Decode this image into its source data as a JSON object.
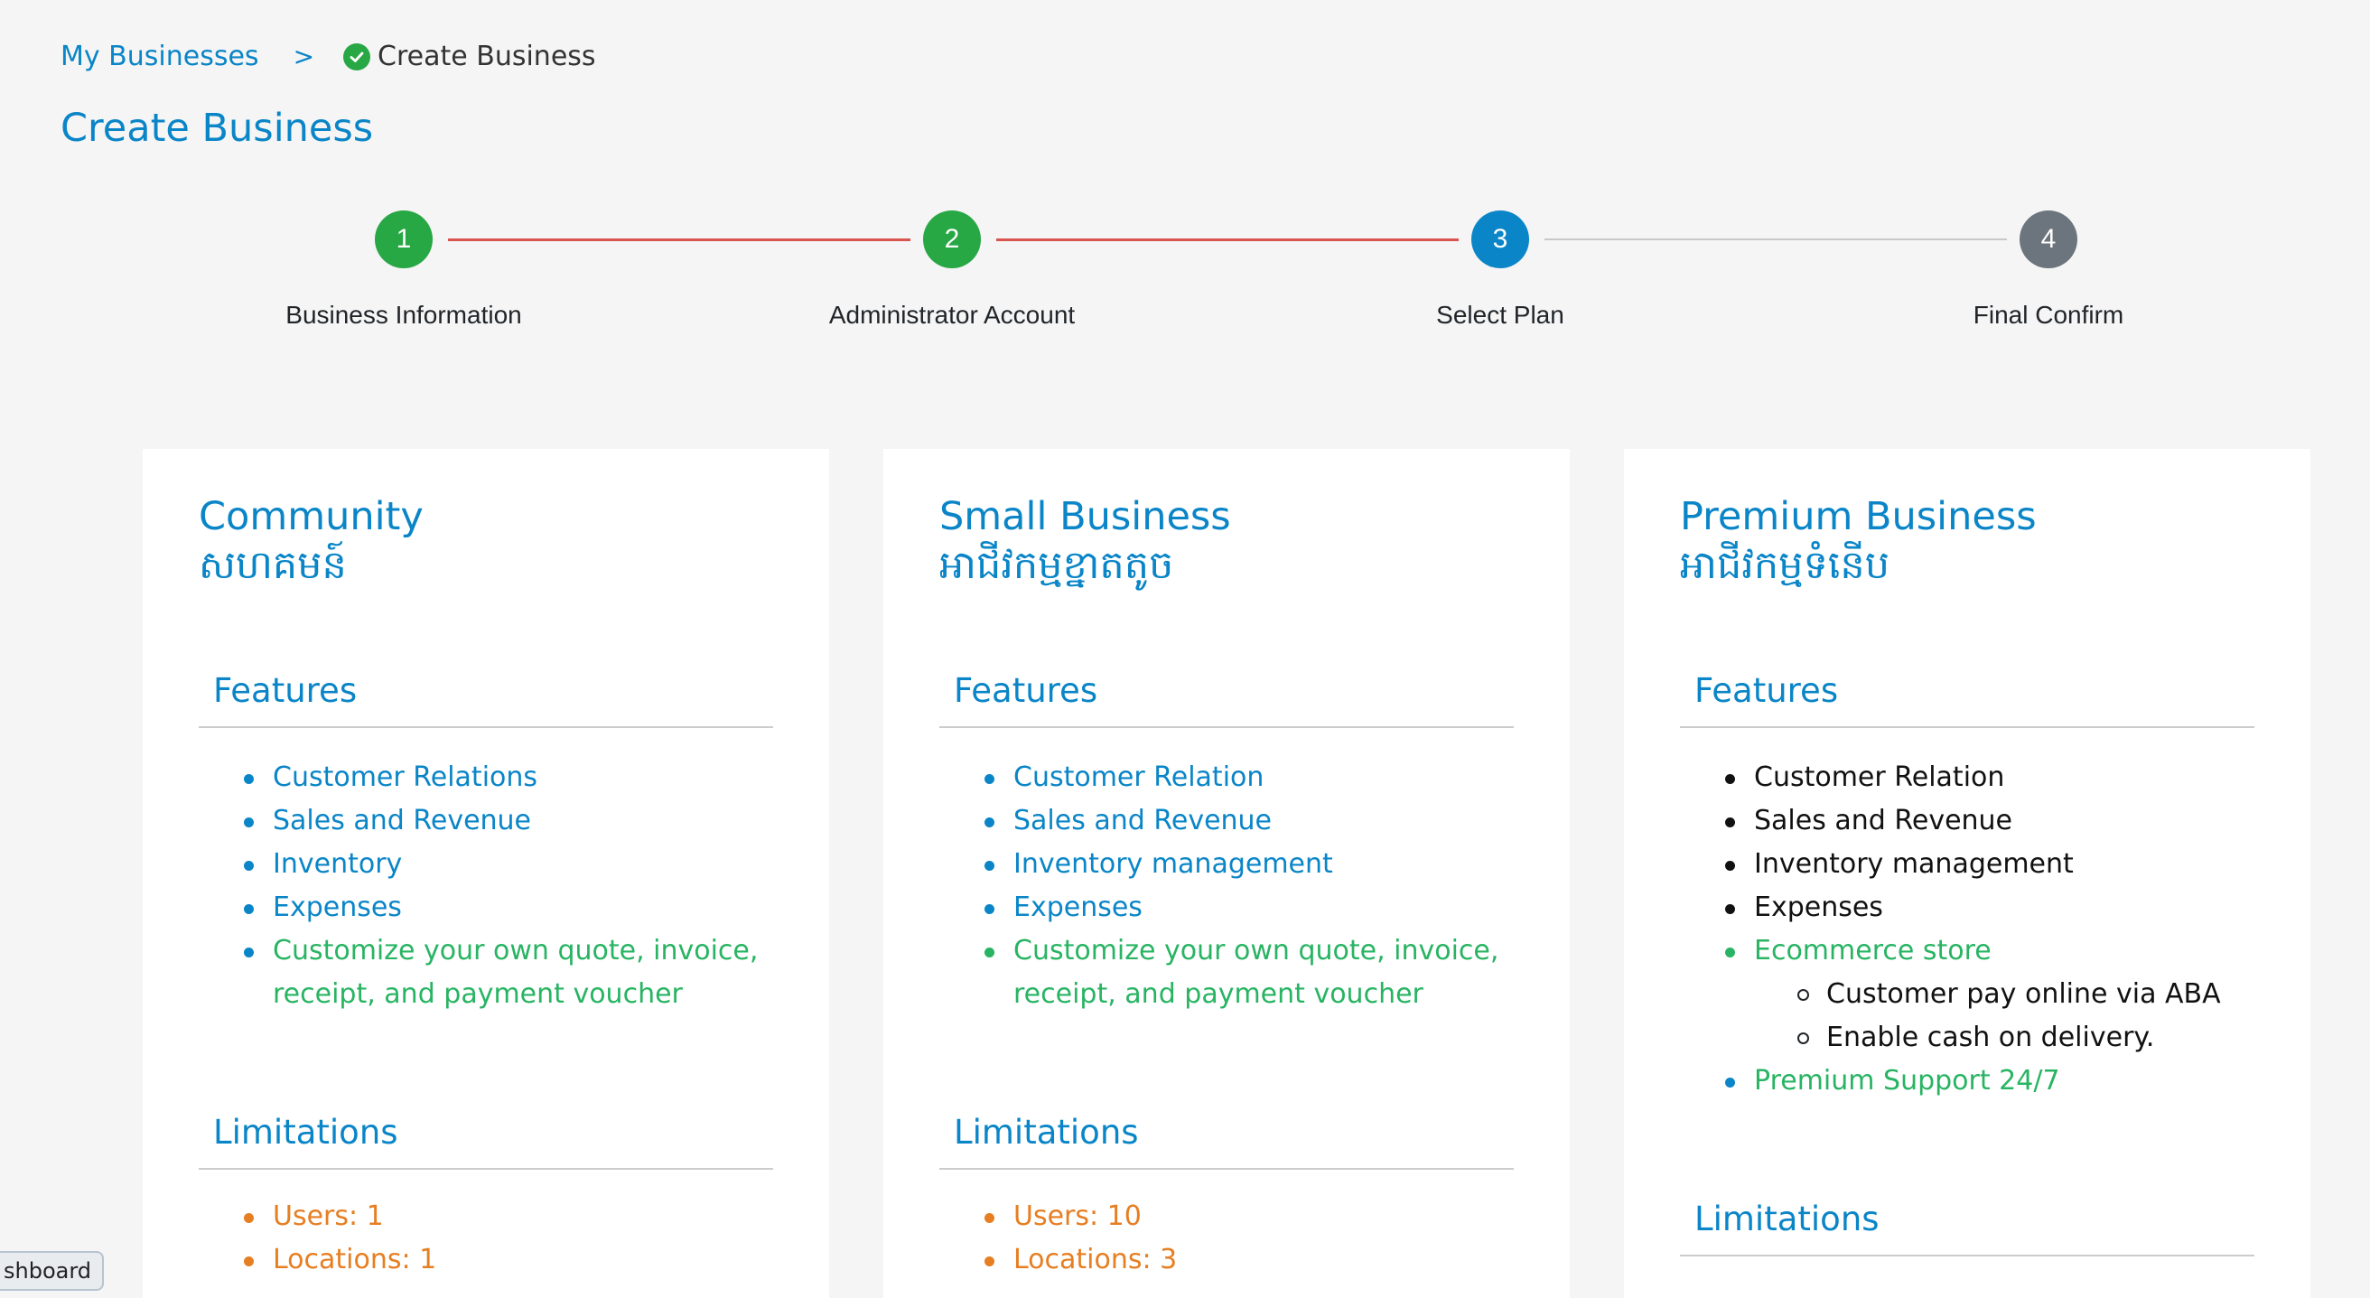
{
  "breadcrumb": {
    "parent": "My Businesses",
    "separator": ">",
    "current": "Create Business"
  },
  "page_title": "Create Business",
  "stepper": {
    "steps": [
      {
        "number": "1",
        "label": "Business Information",
        "status": "completed",
        "color": "#28a745"
      },
      {
        "number": "2",
        "label": "Administrator Account",
        "status": "completed",
        "color": "#28a745"
      },
      {
        "number": "3",
        "label": "Select Plan",
        "status": "active",
        "color": "#0a85c7"
      },
      {
        "number": "4",
        "label": "Final Confirm",
        "status": "pending",
        "color": "#6c757d"
      }
    ],
    "connector_done_color": "#d9534f",
    "connector_pending_color": "#c8c8c8"
  },
  "plans": [
    {
      "title_en": "Community",
      "title_km": "សហគមន៍",
      "features_heading": "Features",
      "features": [
        {
          "text": "Customer Relations",
          "color": "blue"
        },
        {
          "text": "Sales and Revenue",
          "color": "blue"
        },
        {
          "text": "Inventory",
          "color": "blue"
        },
        {
          "text": "Expenses",
          "color": "blue"
        },
        {
          "text": "Customize your own quote, invoice,",
          "color": "green"
        },
        {
          "text": "receipt, and payment voucher",
          "color": "green"
        }
      ],
      "limitations_heading": "Limitations",
      "limitations": [
        "Users: 1",
        "Locations: 1"
      ]
    },
    {
      "title_en": "Small Business",
      "title_km": "អាជីវកម្មខ្នាតតូច",
      "features_heading": "Features",
      "features": [
        {
          "text": "Customer Relation",
          "color": "blue"
        },
        {
          "text": "Sales and Revenue",
          "color": "blue"
        },
        {
          "text": "Inventory management",
          "color": "blue"
        },
        {
          "text": "Expenses",
          "color": "blue"
        },
        {
          "text": "Customize your own quote, invoice,",
          "color": "green"
        },
        {
          "text": "receipt, and payment voucher",
          "color": "green"
        }
      ],
      "limitations_heading": "Limitations",
      "limitations": [
        "Users: 10",
        "Locations: 3"
      ]
    },
    {
      "title_en": "Premium Business",
      "title_km": "អាជីវកម្មទំនើប",
      "features_heading": "Features",
      "features": [
        {
          "text": "Customer Relation",
          "color": "black"
        },
        {
          "text": "Sales and Revenue",
          "color": "black"
        },
        {
          "text": "Inventory management",
          "color": "black"
        },
        {
          "text": "Expenses",
          "color": "black"
        },
        {
          "text": "Ecommerce store",
          "color": "green"
        },
        {
          "text": "Customer pay online via ABA",
          "color": "black",
          "sub": true
        },
        {
          "text": "Enable cash on delivery.",
          "color": "black",
          "sub": true
        },
        {
          "text": "Premium Support 24/7",
          "color": "green"
        }
      ],
      "limitations_heading": "Limitations",
      "limitations": []
    }
  ],
  "dashboard_tab": "shboard"
}
